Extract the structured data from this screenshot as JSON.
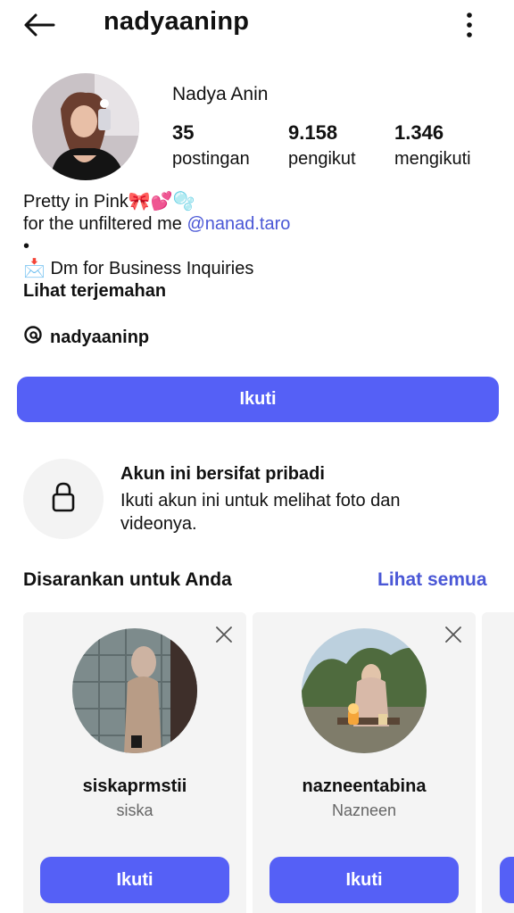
{
  "header": {
    "username": "nadyaaninp",
    "back_icon": "arrow-left-icon",
    "more_icon": "vertical-dots-icon"
  },
  "profile": {
    "display_name": "Nadya Anin",
    "stats": [
      {
        "value": "35",
        "label": "postingan"
      },
      {
        "value": "9.158",
        "label": "pengikut"
      },
      {
        "value": "1.346",
        "label": "mengikuti"
      }
    ],
    "bio": {
      "line1": "Pretty in Pink🎀💕🫧",
      "line2_prefix": "for the unfiltered me ",
      "line2_mention": "@nanad.taro",
      "line3": "•",
      "line4": "📩 Dm for Business Inquiries",
      "translate": "Lihat terjemahan"
    },
    "threads_handle": "nadyaaninp",
    "follow_label": "Ikuti"
  },
  "private_notice": {
    "title": "Akun ini bersifat pribadi",
    "description": "Ikuti akun ini untuk melihat foto dan videonya."
  },
  "suggestions": {
    "title": "Disarankan untuk Anda",
    "see_all": "Lihat semua",
    "cards": [
      {
        "username": "siskaprmstii",
        "name": "siska",
        "button": "Ikuti"
      },
      {
        "username": "nazneentabina",
        "name": "Nazneen",
        "button": "Ikuti"
      }
    ]
  },
  "colors": {
    "accent": "#5560f6",
    "link": "#4a57d6"
  }
}
